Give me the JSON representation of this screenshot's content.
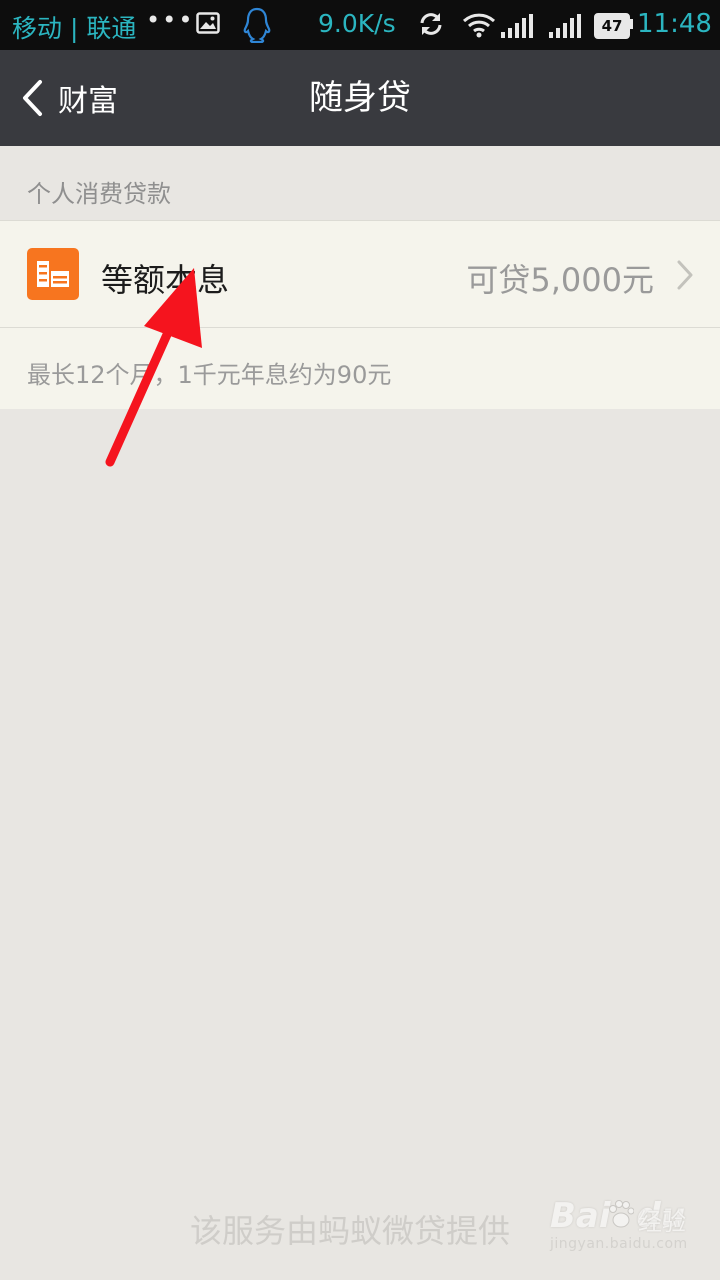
{
  "status_bar": {
    "carrier": "移动 | 联通",
    "dots": "•••",
    "net_speed": "9.0K/s",
    "battery": "47",
    "time": "11:48",
    "icons": [
      "gallery-icon",
      "qq-icon",
      "sync-icon",
      "wifi-icon",
      "signal-icon",
      "signal-icon",
      "battery-icon"
    ]
  },
  "nav": {
    "back_label": "财富",
    "title": "随身贷"
  },
  "section": {
    "header": "个人消费贷款"
  },
  "loan_item": {
    "title": "等额本息",
    "amount": "可贷5,000元",
    "description": "最长12个月，1千元年息约为90元",
    "icon": "loan-icon",
    "icon_color": "#f7751f"
  },
  "footer": {
    "provider": "该服务由蚂蚁微贷提供"
  },
  "watermark": {
    "logo": "Bai",
    "logo_tail": "du",
    "label": "经验",
    "url": "jingyan.baidu.com"
  },
  "colors": {
    "status_text": "#2bb5c0",
    "navbar": "#393a3f",
    "background": "#e8e6e2",
    "card": "#f5f4ec",
    "annotation_arrow": "#f5141e"
  }
}
